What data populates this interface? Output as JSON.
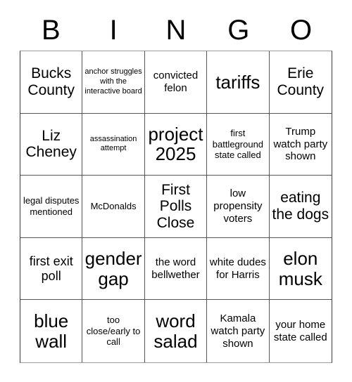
{
  "card": {
    "title": "BINGO",
    "columns": 5,
    "rows": 5,
    "header_letters": [
      "B",
      "I",
      "N",
      "G",
      "O"
    ],
    "colors": {
      "background": "#ffffff",
      "text": "#000000",
      "grid_line": "#555555",
      "outer_border": "#3a3a3a"
    },
    "cells": [
      {
        "text": "Bucks County",
        "size": "xl"
      },
      {
        "text": "anchor struggles with the interactive board",
        "size": "xs"
      },
      {
        "text": "convicted felon",
        "size": "md"
      },
      {
        "text": "tariffs",
        "size": "xxl"
      },
      {
        "text": "Erie County",
        "size": "xl"
      },
      {
        "text": "Liz Cheney",
        "size": "xl"
      },
      {
        "text": "assassination attempt",
        "size": "xs"
      },
      {
        "text": "project 2025",
        "size": "xxl"
      },
      {
        "text": "first battleground state called",
        "size": "sm"
      },
      {
        "text": "Trump watch party shown",
        "size": "md"
      },
      {
        "text": "legal disputes mentioned",
        "size": "sm"
      },
      {
        "text": "McDonalds",
        "size": "sm"
      },
      {
        "text": "First Polls Close",
        "size": "xl"
      },
      {
        "text": "low propensity voters",
        "size": "md"
      },
      {
        "text": "eating the dogs",
        "size": "xl"
      },
      {
        "text": "first exit poll",
        "size": "lg"
      },
      {
        "text": "gender gap",
        "size": "xxl"
      },
      {
        "text": "the word bellwether",
        "size": "md"
      },
      {
        "text": "white dudes for Harris",
        "size": "md"
      },
      {
        "text": "elon musk",
        "size": "xxl"
      },
      {
        "text": "blue wall",
        "size": "xxl"
      },
      {
        "text": "too close/early to call",
        "size": "sm"
      },
      {
        "text": "word salad",
        "size": "xxl"
      },
      {
        "text": "Kamala watch party shown",
        "size": "md"
      },
      {
        "text": "your home state called",
        "size": "md"
      }
    ]
  }
}
